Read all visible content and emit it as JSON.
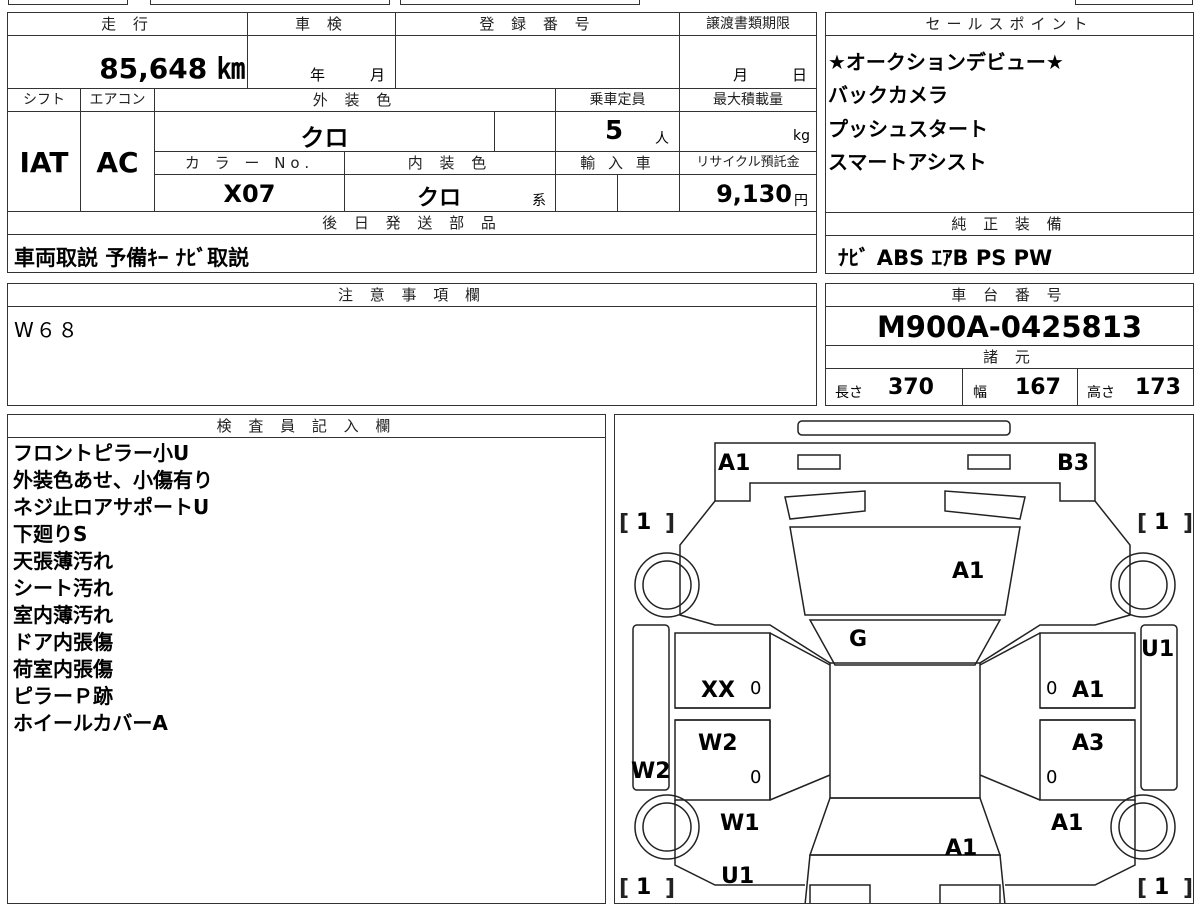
{
  "top_table": {
    "mileage_label": "走 行",
    "mileage_value": "85,648 ㎞",
    "inspection_label": "車 検",
    "inspection_year": "年",
    "inspection_month": "月",
    "reg_label": "登 録 番 号",
    "transfer_label": "譲渡書類期限",
    "transfer_month": "月",
    "transfer_day": "日",
    "shift_label": "シフト",
    "ac_label": "エアコン",
    "exterior_label": "外 装 色",
    "capacity_label": "乗車定員",
    "maxload_label": "最大積載量",
    "shift_value": "IAT",
    "ac_value": "AC",
    "exterior_value": "クロ",
    "capacity_value": "5",
    "capacity_unit": "人",
    "maxload_unit": "kg",
    "colorno_label": "カ ラ ー No.",
    "interior_label": "内 装 色",
    "import_label": "輸 入 車",
    "recycle_label": "リサイクル預託金",
    "colorno_value": "X07",
    "interior_value": "クロ",
    "interior_unit": "系",
    "recycle_value": "9,130",
    "recycle_unit": "円",
    "later_parts_label": "後 日 発 送 部 品",
    "later_parts_value": "車両取説 予備ｷｰ ﾅﾋﾞ取説"
  },
  "sales_points": {
    "label": "セールスポイント",
    "items": [
      "★オークションデビュー★",
      "バックカメラ",
      "プッシュスタート",
      "スマートアシスト"
    ]
  },
  "equipment": {
    "label": "純 正 装 備",
    "value": "ﾅﾋﾞ ABS ｴｱB PS PW"
  },
  "notes": {
    "label": "注 意 事 項 欄",
    "value": "W６８"
  },
  "chassis": {
    "label": "車 台 番 号",
    "value": "M900A-0425813",
    "specs_label": "諸 元",
    "length_label": "長さ",
    "length_value": "370",
    "width_label": "幅",
    "width_value": "167",
    "height_label": "高さ",
    "height_value": "173"
  },
  "inspector": {
    "label": "検 査 員 記 入 欄",
    "lines": [
      "フロントピラー小U",
      "外装色あせ、小傷有り",
      "ネジ止ロアサポートU",
      "下廻りS",
      "天張薄汚れ",
      "シート汚れ",
      "室内薄汚れ",
      "ドア内張傷",
      "荷室内張傷",
      "ピラーＰ跡",
      "ホイールカバーA"
    ]
  },
  "diagram": {
    "marks": {
      "front_left": "A1",
      "front_right": "B3",
      "hood": "A1",
      "windshield": "G",
      "door_fl": "XX",
      "door_rl": "W2",
      "door_fr": "A1",
      "door_rr": "A3",
      "rear_left": "W1",
      "rear_right": "A1",
      "rear_center": "A1",
      "bottom_left": "U1",
      "left_side": "W2",
      "right_side": "U1",
      "tire_fl": "1",
      "tire_fr": "1",
      "tire_rl": "1",
      "tire_rr": "1",
      "zero_1": "0",
      "zero_2": "0",
      "zero_3": "0",
      "zero_4": "0"
    }
  }
}
